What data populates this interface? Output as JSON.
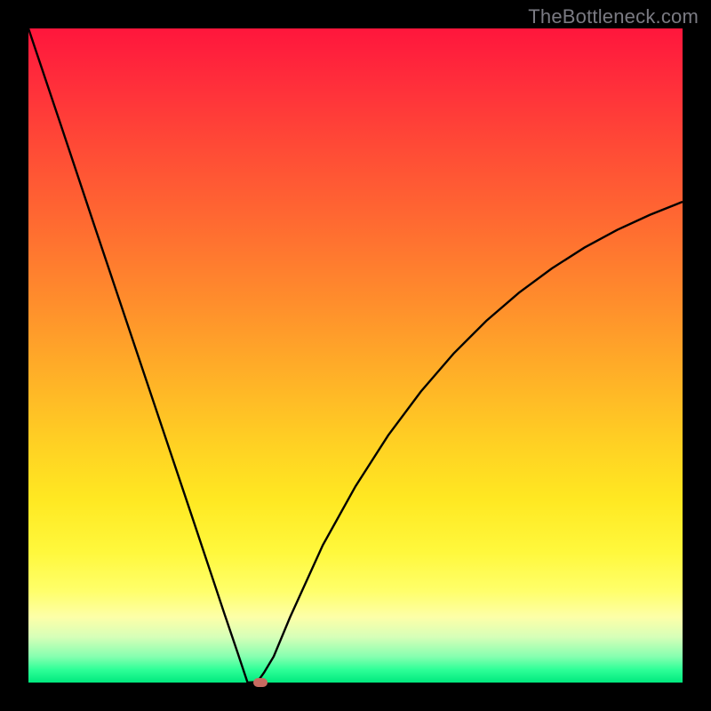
{
  "watermark": "TheBottleneck.com",
  "colors": {
    "marker_fill": "#c76a60",
    "curve_stroke": "#000000",
    "frame": "#000000"
  },
  "chart_data": {
    "type": "line",
    "title": "",
    "xlabel": "",
    "ylabel": "",
    "xlim": [
      0,
      100
    ],
    "ylim": [
      0,
      100
    ],
    "grid": false,
    "series": [
      {
        "name": "bottleneck-curve",
        "x": [
          0,
          5,
          10,
          15,
          20,
          25,
          28,
          30,
          32,
          33.5,
          35,
          36,
          37.5,
          40,
          45,
          50,
          55,
          60,
          65,
          70,
          75,
          80,
          85,
          90,
          95,
          100
        ],
        "y": [
          100,
          85.1,
          70.1,
          55.2,
          40.3,
          25.4,
          16.4,
          10.4,
          4.5,
          0,
          0.1,
          1.5,
          4,
          10,
          21,
          30,
          37.8,
          44.5,
          50.3,
          55.3,
          59.6,
          63.3,
          66.5,
          69.2,
          71.5,
          73.5
        ]
      }
    ],
    "annotations": [
      {
        "name": "optimal-marker",
        "x": 35.5,
        "y": 0
      }
    ]
  }
}
